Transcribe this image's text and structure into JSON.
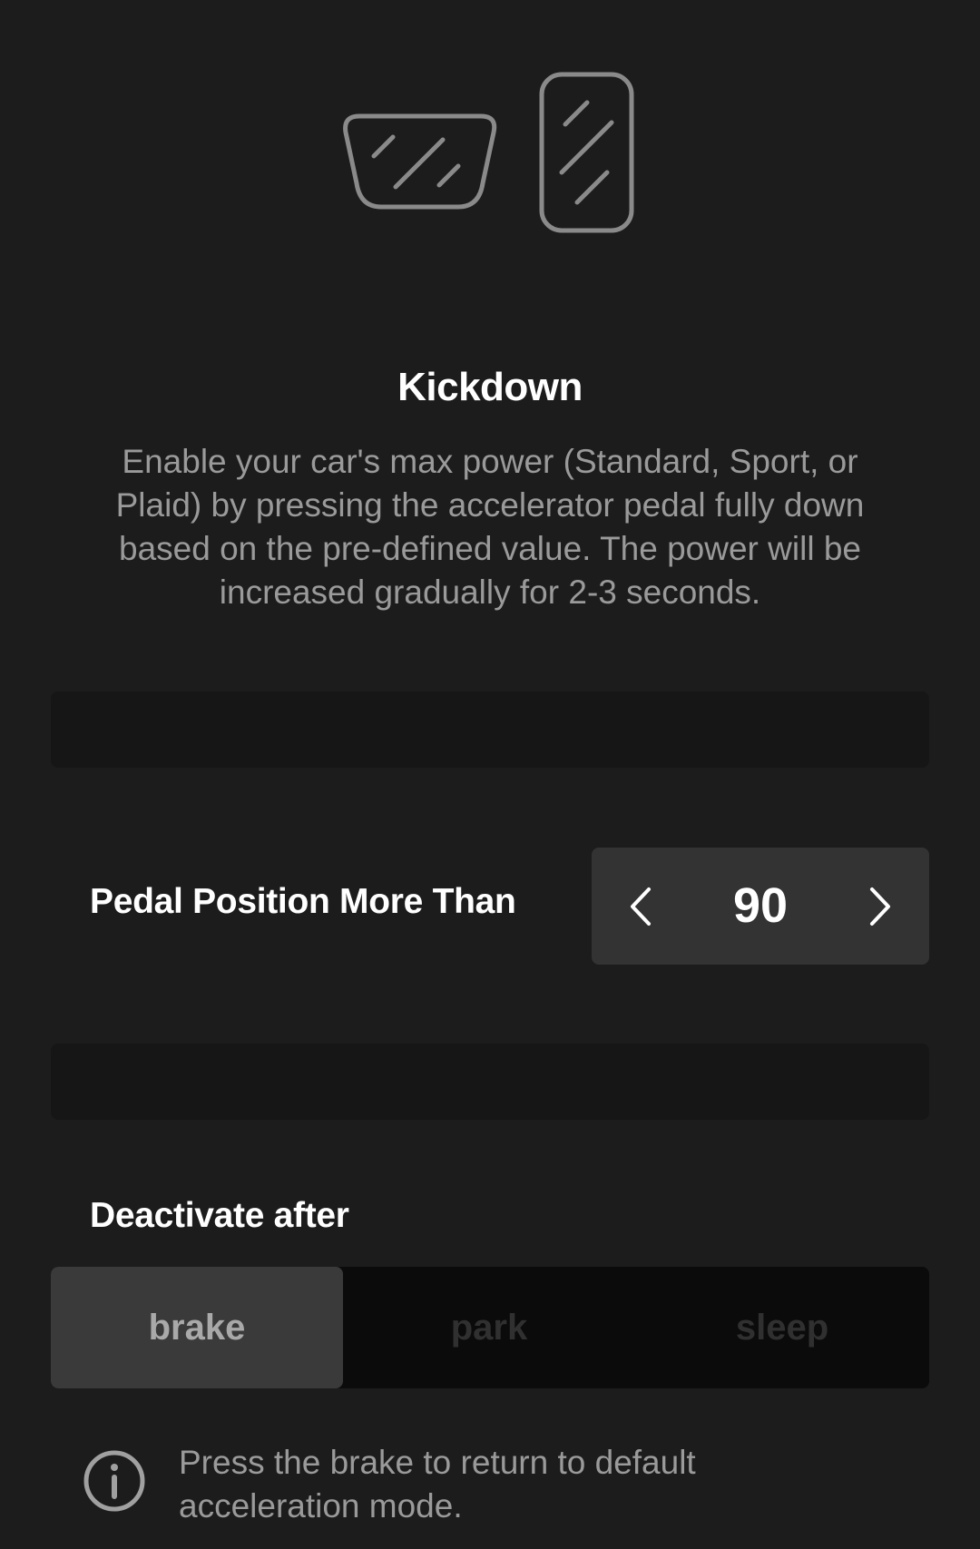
{
  "hero": {
    "icon_left": "brake-pedal-icon",
    "icon_right": "accelerator-pedal-icon"
  },
  "title": "Kickdown",
  "description": "Enable your car's max power (Standard, Sport, or Plaid) by pressing the accelerator pedal fully down based on the pre-defined value. The power will be increased gradually for 2-3 seconds.",
  "pedal_setting": {
    "label": "Pedal Position More Than",
    "value": "90",
    "prev_icon": "chevron-left-icon",
    "next_icon": "chevron-right-icon"
  },
  "deactivate": {
    "label": "Deactivate after",
    "options": [
      "brake",
      "park",
      "sleep"
    ],
    "selected": "brake"
  },
  "info": {
    "icon": "info-icon",
    "text": "Press the brake to return to default acceleration mode."
  },
  "colors": {
    "background": "#1c1c1c",
    "text_primary": "#ffffff",
    "text_secondary": "#9a9a9a",
    "stepper_bg": "#333333",
    "segment_active_bg": "#3a3a3a",
    "segment_bg": "#0b0b0b"
  }
}
